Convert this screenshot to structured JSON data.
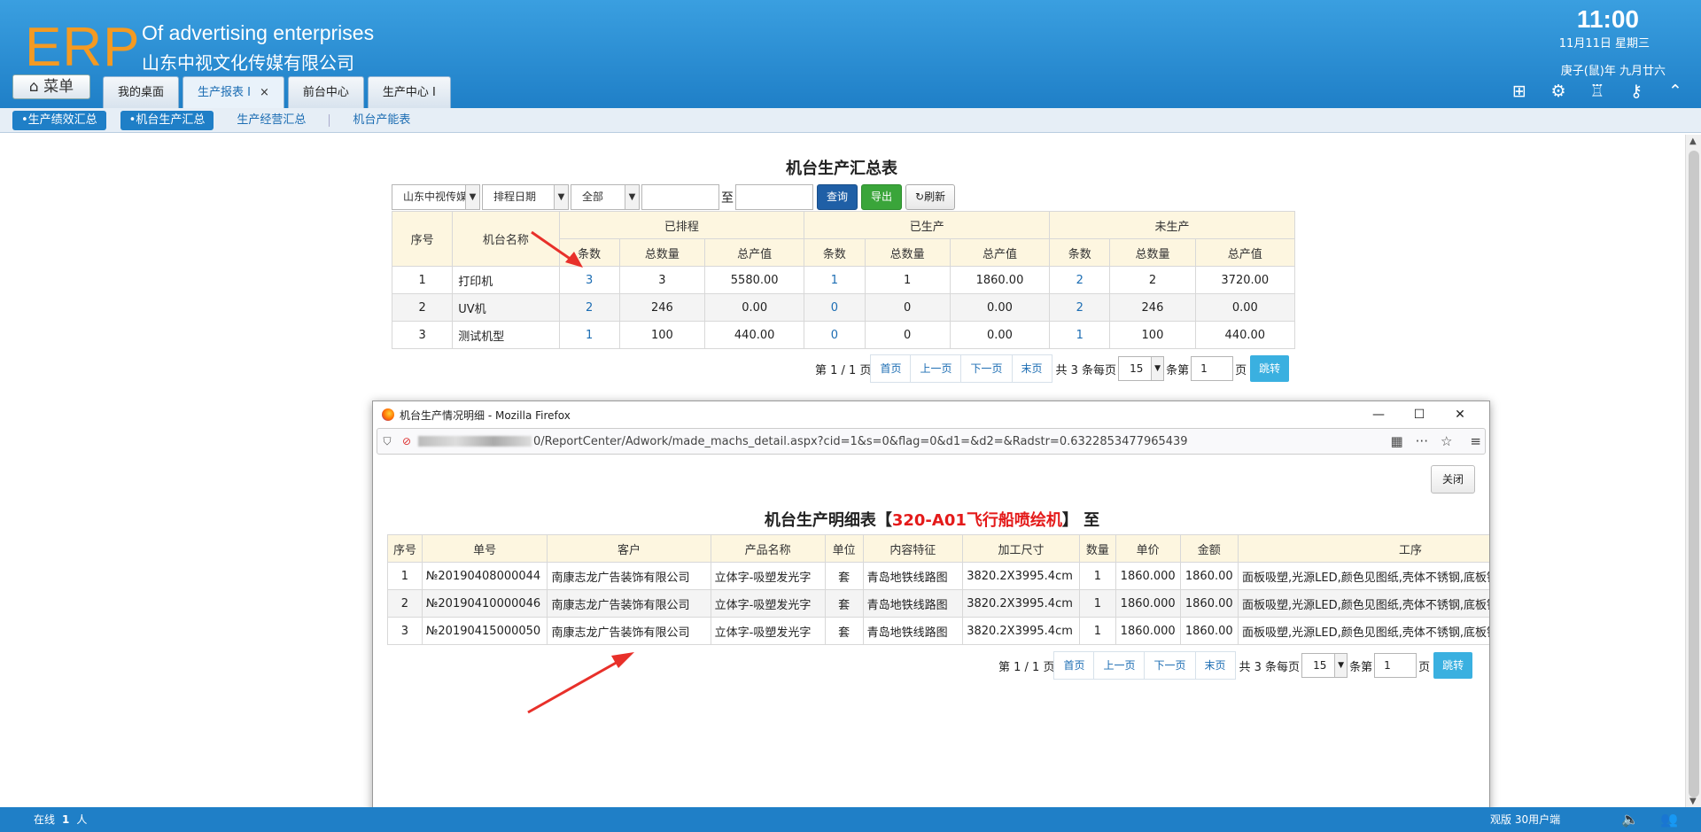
{
  "header": {
    "logo": "ERP",
    "company_en": "Of advertising enterprises",
    "company_cn": "山东中视文化传媒有限公司",
    "time": "11:00",
    "date": "11月11日 星期三",
    "lunar": "庚子(鼠)年 九月廿六",
    "menu_label": "菜单",
    "tabs": [
      {
        "label": "我的桌面"
      },
      {
        "label": "生产报表 I",
        "close": "×"
      },
      {
        "label": "前台中心"
      },
      {
        "label": "生产中心 I"
      }
    ]
  },
  "subnav": {
    "items": [
      "•生产绩效汇总",
      "•机台生产汇总",
      "生产经营汇总",
      "机台产能表"
    ]
  },
  "report": {
    "title": "机台生产汇总表",
    "filters": {
      "company": "山东中视传媒",
      "date_type": "排程日期",
      "status": "全部",
      "to": "至",
      "query": "查询",
      "export": "导出",
      "refresh": "刷新"
    },
    "head": {
      "no": "序号",
      "name": "机台名称",
      "scheduled": "已排程",
      "produced": "已生产",
      "unproduced": "未生产",
      "count": "条数",
      "qty": "总数量",
      "value": "总产值"
    },
    "rows": [
      {
        "no": "1",
        "name": "打印机",
        "s_cnt": "3",
        "s_qty": "3",
        "s_val": "5580.00",
        "p_cnt": "1",
        "p_qty": "1",
        "p_val": "1860.00",
        "u_cnt": "2",
        "u_qty": "2",
        "u_val": "3720.00"
      },
      {
        "no": "2",
        "name": "UV机",
        "s_cnt": "2",
        "s_qty": "246",
        "s_val": "0.00",
        "p_cnt": "0",
        "p_qty": "0",
        "p_val": "0.00",
        "u_cnt": "2",
        "u_qty": "246",
        "u_val": "0.00"
      },
      {
        "no": "3",
        "name": "测试机型",
        "s_cnt": "1",
        "s_qty": "100",
        "s_val": "440.00",
        "p_cnt": "0",
        "p_qty": "0",
        "p_val": "0.00",
        "u_cnt": "1",
        "u_qty": "100",
        "u_val": "440.00"
      }
    ],
    "pager": {
      "info": "第 1 / 1 页",
      "first": "首页",
      "prev": "上一页",
      "next": "下一页",
      "last": "末页",
      "total": "共 3 条每页",
      "per_page": "15",
      "goto_prefix": "条第",
      "page": "1",
      "goto_suffix": "页",
      "go": "跳转"
    }
  },
  "popup": {
    "window_title": "机台生产情况明细 - Mozilla Firefox",
    "url": "0/ReportCenter/Adwork/made_machs_detail.aspx?cid=1&s=0&flag=0&d1=&d2=&Radstr=0.6322853477965439",
    "close_btn": "关闭",
    "title_prefix": "机台生产明细表【",
    "title_machine": "320-A01飞行船喷绘机",
    "title_suffix": "】 至",
    "cols": [
      "序号",
      "单号",
      "客户",
      "产品名称",
      "单位",
      "内容特征",
      "加工尺寸",
      "数量",
      "单价",
      "金额",
      "工序"
    ],
    "rows": [
      {
        "no": "1",
        "order": "№20190408000044",
        "customer": "南康志龙广告装饰有限公司",
        "product": "立体字-吸塑发光字",
        "unit": "套",
        "feature": "青岛地铁线路图",
        "size": "3820.2X3995.4cm",
        "qty": "1",
        "price": "1860.000",
        "amount": "1860.00",
        "process": "面板吸塑,光源LED,颜色见图纸,壳体不锈钢,底板镀"
      },
      {
        "no": "2",
        "order": "№20190410000046",
        "customer": "南康志龙广告装饰有限公司",
        "product": "立体字-吸塑发光字",
        "unit": "套",
        "feature": "青岛地铁线路图",
        "size": "3820.2X3995.4cm",
        "qty": "1",
        "price": "1860.000",
        "amount": "1860.00",
        "process": "面板吸塑,光源LED,颜色见图纸,壳体不锈钢,底板镀"
      },
      {
        "no": "3",
        "order": "№20190415000050",
        "customer": "南康志龙广告装饰有限公司",
        "product": "立体字-吸塑发光字",
        "unit": "套",
        "feature": "青岛地铁线路图",
        "size": "3820.2X3995.4cm",
        "qty": "1",
        "price": "1860.000",
        "amount": "1860.00",
        "process": "面板吸塑,光源LED,颜色见图纸,壳体不锈钢,底板镀"
      }
    ],
    "pager": {
      "info": "第 1 / 1 页",
      "first": "首页",
      "prev": "上一页",
      "next": "下一页",
      "last": "末页",
      "total": "共 3 条每页",
      "per_page": "15",
      "goto_prefix": "条第",
      "page": "1",
      "goto_suffix": "页",
      "go": "跳转"
    }
  },
  "footer": {
    "online_label": "在线",
    "online_count": "1",
    "online_unit": "人",
    "version": "观版 30用户端"
  },
  "colors": {
    "header_blue": "#1f7fc7",
    "logo_orange": "#f49a22",
    "link_blue": "#1c6db3",
    "annotation_red": "#e8302a"
  }
}
